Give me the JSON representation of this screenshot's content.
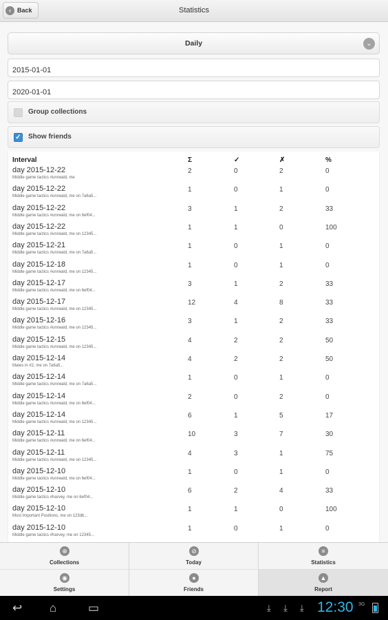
{
  "header": {
    "back_label": "Back",
    "title": "Statistics"
  },
  "filters": {
    "period": "Daily",
    "start_date": "2015-01-01",
    "end_date": "2020-01-01",
    "group_collections": {
      "label": "Group collections",
      "checked": false
    },
    "show_friends": {
      "label": "Show friends",
      "checked": true
    }
  },
  "table": {
    "headers": [
      "Interval",
      "Σ",
      "✓",
      "✗",
      "%"
    ],
    "rows": [
      {
        "interval": "day 2015-12-22",
        "desc": "Middle game tactics #unrwald, me",
        "total": "2",
        "correct": "0",
        "wrong": "2",
        "percent": "0"
      },
      {
        "interval": "day 2015-12-22",
        "desc": "Middle game tactics #unrwald, me on 7a6a5...",
        "total": "1",
        "correct": "0",
        "wrong": "1",
        "percent": "0"
      },
      {
        "interval": "day 2015-12-22",
        "desc": "Middle game tactics #unrwald, me on 6ef04...",
        "total": "3",
        "correct": "1",
        "wrong": "2",
        "percent": "33"
      },
      {
        "interval": "day 2015-12-22",
        "desc": "Middle game tactics #unrwald, me on 12345...",
        "total": "1",
        "correct": "1",
        "wrong": "0",
        "percent": "100"
      },
      {
        "interval": "day 2015-12-21",
        "desc": "Middle game tactics #unrwald, me on 7a6a5...",
        "total": "1",
        "correct": "0",
        "wrong": "1",
        "percent": "0"
      },
      {
        "interval": "day 2015-12-18",
        "desc": "Middle game tactics #unrwald, me on 12345...",
        "total": "1",
        "correct": "0",
        "wrong": "1",
        "percent": "0"
      },
      {
        "interval": "day 2015-12-17",
        "desc": "Middle game tactics #unrwald, me on 6ef04...",
        "total": "3",
        "correct": "1",
        "wrong": "2",
        "percent": "33"
      },
      {
        "interval": "day 2015-12-17",
        "desc": "Middle game tactics #unrwald, me on 12345...",
        "total": "12",
        "correct": "4",
        "wrong": "8",
        "percent": "33"
      },
      {
        "interval": "day 2015-12-16",
        "desc": "Middle game tactics #unrwald, me on 12345...",
        "total": "3",
        "correct": "1",
        "wrong": "2",
        "percent": "33"
      },
      {
        "interval": "day 2015-12-15",
        "desc": "Middle game tactics #unrwald, me on 12345...",
        "total": "4",
        "correct": "2",
        "wrong": "2",
        "percent": "50"
      },
      {
        "interval": "day 2015-12-14",
        "desc": "Mates in #2, me on 7a6a5...",
        "total": "4",
        "correct": "2",
        "wrong": "2",
        "percent": "50"
      },
      {
        "interval": "day 2015-12-14",
        "desc": "Middle game tactics #unrwald, me on 7a6a5...",
        "total": "1",
        "correct": "0",
        "wrong": "1",
        "percent": "0"
      },
      {
        "interval": "day 2015-12-14",
        "desc": "Middle game tactics #unrwald, me on 6ef04...",
        "total": "2",
        "correct": "0",
        "wrong": "2",
        "percent": "0"
      },
      {
        "interval": "day 2015-12-14",
        "desc": "Middle game tactics #unrwald, me on 12345...",
        "total": "6",
        "correct": "1",
        "wrong": "5",
        "percent": "17"
      },
      {
        "interval": "day 2015-12-11",
        "desc": "Middle game tactics #unrwald, me on 6ef04...",
        "total": "10",
        "correct": "3",
        "wrong": "7",
        "percent": "30"
      },
      {
        "interval": "day 2015-12-11",
        "desc": "Middle game tactics #unrwald, me on 12345...",
        "total": "4",
        "correct": "3",
        "wrong": "1",
        "percent": "75"
      },
      {
        "interval": "day 2015-12-10",
        "desc": "Middle game tactics #unrwald, me on 6ef04...",
        "total": "1",
        "correct": "0",
        "wrong": "1",
        "percent": "0"
      },
      {
        "interval": "day 2015-12-10",
        "desc": "Middle game tactics #harvey, me on 6ef04...",
        "total": "6",
        "correct": "2",
        "wrong": "4",
        "percent": "33"
      },
      {
        "interval": "day 2015-12-10",
        "desc": "Most Important Positions, me on 123db...",
        "total": "1",
        "correct": "1",
        "wrong": "0",
        "percent": "100"
      },
      {
        "interval": "day 2015-12-10",
        "desc": "Middle game tactics #harvey, me on 12345...",
        "total": "1",
        "correct": "0",
        "wrong": "1",
        "percent": "0"
      }
    ]
  },
  "tabs": [
    {
      "label": "Collections",
      "icon": "grid-globe-icon",
      "selected": false
    },
    {
      "label": "Today",
      "icon": "no-entry-icon",
      "selected": false
    },
    {
      "label": "Statistics",
      "icon": "list-icon",
      "selected": false
    },
    {
      "label": "Settings",
      "icon": "settings-icon",
      "selected": false
    },
    {
      "label": "Friends",
      "icon": "person-icon",
      "selected": false
    },
    {
      "label": "Report",
      "icon": "triangle-up-icon",
      "selected": true
    }
  ],
  "system": {
    "clock": "12:30",
    "signal": "3G"
  }
}
